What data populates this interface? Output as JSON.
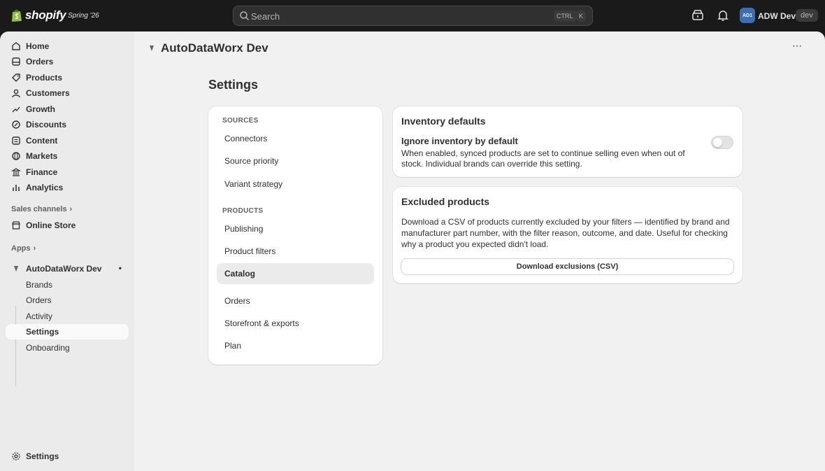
{
  "topbar": {
    "logo_text": "shopify",
    "edition": "Spring '26",
    "search_placeholder": "Search",
    "shortcut_ctrl": "CTRL",
    "shortcut_k": "K",
    "avatar_initials": "AD1",
    "store_name": "ADW Dev 1",
    "dev_badge": "dev"
  },
  "sidebar": {
    "items": [
      {
        "label": "Home",
        "icon": "home-icon"
      },
      {
        "label": "Orders",
        "icon": "orders-icon"
      },
      {
        "label": "Products",
        "icon": "products-icon"
      },
      {
        "label": "Customers",
        "icon": "customers-icon"
      },
      {
        "label": "Growth",
        "icon": "growth-icon"
      },
      {
        "label": "Discounts",
        "icon": "discounts-icon"
      },
      {
        "label": "Content",
        "icon": "content-icon"
      },
      {
        "label": "Markets",
        "icon": "markets-icon"
      },
      {
        "label": "Finance",
        "icon": "finance-icon"
      },
      {
        "label": "Analytics",
        "icon": "analytics-icon"
      }
    ],
    "sales_channels_label": "Sales channels",
    "online_store_label": "Online Store",
    "apps_label": "Apps",
    "app": {
      "name": "AutoDataWorx Dev",
      "sub_items": [
        "Brands",
        "Orders",
        "Activity",
        "Settings",
        "Onboarding"
      ],
      "active_sub": "Settings"
    },
    "settings_label": "Settings"
  },
  "main": {
    "app_title": "AutoDataWorx Dev",
    "page_title": "Settings",
    "menu": {
      "sources_heading": "SOURCES",
      "sources": [
        "Connectors",
        "Source priority",
        "Variant strategy"
      ],
      "products_heading": "PRODUCTS",
      "products": [
        "Publishing",
        "Product filters",
        "Catalog"
      ],
      "active": "Catalog",
      "other": [
        "Orders",
        "Storefront & exports",
        "Plan"
      ]
    },
    "inventory": {
      "title": "Inventory defaults",
      "setting_title": "Ignore inventory by default",
      "description": "When enabled, synced products are set to continue selling even when out of stock. Individual brands can override this setting.",
      "toggle_on": false
    },
    "excluded": {
      "title": "Excluded products",
      "description": "Download a CSV of products currently excluded by your filters — identified by brand and manufacturer part number, with the filter reason, outcome, and date. Useful for checking why a product you expected didn't load.",
      "button_label": "Download exclusions (CSV)"
    }
  }
}
